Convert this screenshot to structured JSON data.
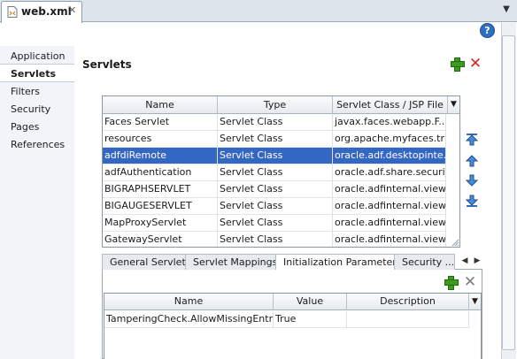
{
  "editor": {
    "tab_title": "web.xml",
    "close_glyph": "✕",
    "menu_glyph": "▼",
    "help_glyph": "?"
  },
  "nav": {
    "items": [
      {
        "label": "Application"
      },
      {
        "label": "Servlets",
        "selected": true
      },
      {
        "label": "Filters"
      },
      {
        "label": "Security"
      },
      {
        "label": "Pages"
      },
      {
        "label": "References"
      }
    ]
  },
  "section": {
    "title": "Servlets",
    "add_icon": "add-icon",
    "delete_icon": "delete-icon"
  },
  "servlets": {
    "columns": [
      "Name",
      "Type",
      "Servlet Class / JSP File"
    ],
    "rows": [
      [
        "Faces Servlet",
        "Servlet Class",
        "javax.faces.webapp.F..."
      ],
      [
        "resources",
        "Servlet Class",
        "org.apache.myfaces.tri..."
      ],
      [
        "adfdiRemote",
        "Servlet Class",
        "oracle.adf.desktopinte..."
      ],
      [
        "adfAuthentication",
        "Servlet Class",
        "oracle.adf.share.securi..."
      ],
      [
        "BIGRAPHSERVLET",
        "Servlet Class",
        "oracle.adfinternal.view..."
      ],
      [
        "BIGAUGESERVLET",
        "Servlet Class",
        "oracle.adfinternal.view..."
      ],
      [
        "MapProxyServlet",
        "Servlet Class",
        "oracle.adfinternal.view..."
      ],
      [
        "GatewayServlet",
        "Servlet Class",
        "oracle.adfinternal.view..."
      ]
    ],
    "selected_index": 2,
    "reorder_icons": [
      "move-to-top-icon",
      "move-up-icon",
      "move-down-icon",
      "move-to-bottom-icon"
    ]
  },
  "detail_tabs": {
    "tabs": [
      "General Servlet",
      "Servlet Mappings",
      "Initialization Parameters",
      "Security ..."
    ],
    "active_index": 2,
    "scroll_left": "◀",
    "scroll_right": "▶"
  },
  "params": {
    "columns": [
      "Name",
      "Value",
      "Description"
    ],
    "rows": [
      [
        "TamperingCheck.AllowMissingEntries",
        "True",
        ""
      ]
    ]
  },
  "colors": {
    "selection": "#3466c4",
    "add_green": "#3d9a1e",
    "delete_red": "#d12a1c"
  }
}
